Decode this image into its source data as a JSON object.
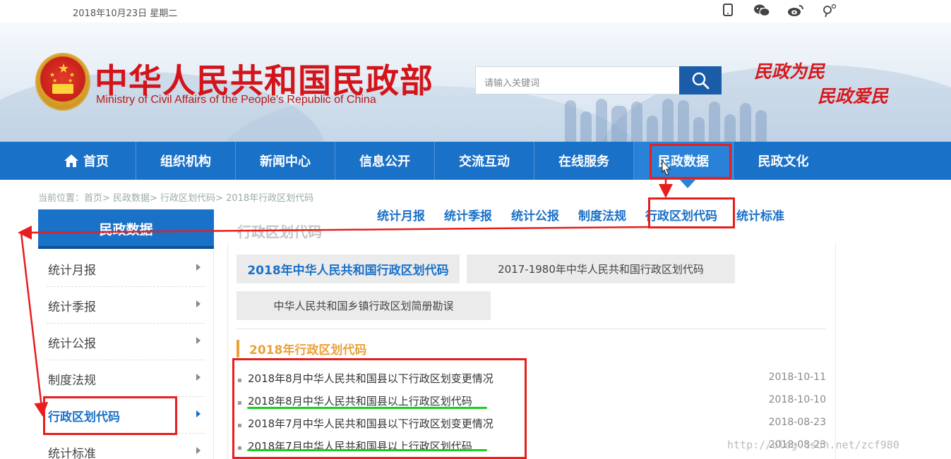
{
  "topbar": {
    "date": "2018年10月23日  星期二",
    "icons": [
      "mobile-icon",
      "wechat-icon",
      "weibo-icon",
      "accessibility-icon"
    ]
  },
  "header": {
    "title_cn": "中华人民共和国民政部",
    "title_en": "Ministry of Civil Affairs of the People's Republic of China",
    "slogan_line1": "民政为民",
    "slogan_line2": "民政爱民",
    "search_placeholder": "请输入关键词"
  },
  "nav": {
    "items": [
      "首页",
      "组织机构",
      "新闻中心",
      "信息公开",
      "交流互动",
      "在线服务",
      "民政数据",
      "民政文化"
    ],
    "active_index": 6
  },
  "breadcrumb": "当前位置：首页> 民政数据> 行政区划代码> 2018年行政区划代码",
  "subnav": {
    "items": [
      "统计月报",
      "统计季报",
      "统计公报",
      "制度法规",
      "行政区划代码",
      "统计标准"
    ],
    "highlighted_index": 4
  },
  "sidebar": {
    "heading": "民政数据",
    "items": [
      "统计月报",
      "统计季报",
      "统计公报",
      "制度法规",
      "行政区划代码",
      "统计标准"
    ],
    "active_index": 4
  },
  "main": {
    "title": "行政区划代码",
    "tabs": [
      "2018年中华人民共和国行政区划代码",
      "2017-1980年中华人民共和国行政区划代码",
      "中华人民共和国乡镇行政区划简册勘误"
    ],
    "section_title": "2018年行政区划代码",
    "news": [
      {
        "title": "2018年8月中华人民共和国县以下行政区划变更情况",
        "date": "2018-10-11"
      },
      {
        "title": "2018年8月中华人民共和国县以上行政区划代码",
        "date": "2018-10-10"
      },
      {
        "title": "2018年7月中华人民共和国县以下行政区划变更情况",
        "date": "2018-08-23"
      },
      {
        "title": "2018年7月中华人民共和国县以上行政区划代码",
        "date": "2018-08-23"
      }
    ]
  },
  "watermark": "http://blog.csdn.net/zcf980",
  "colors": {
    "nav_blue": "#1a71c8",
    "brand_red": "#d3151b",
    "annotation_red": "#e81d1d",
    "annotation_green": "#14d21e",
    "section_orange": "#e9a23b"
  }
}
